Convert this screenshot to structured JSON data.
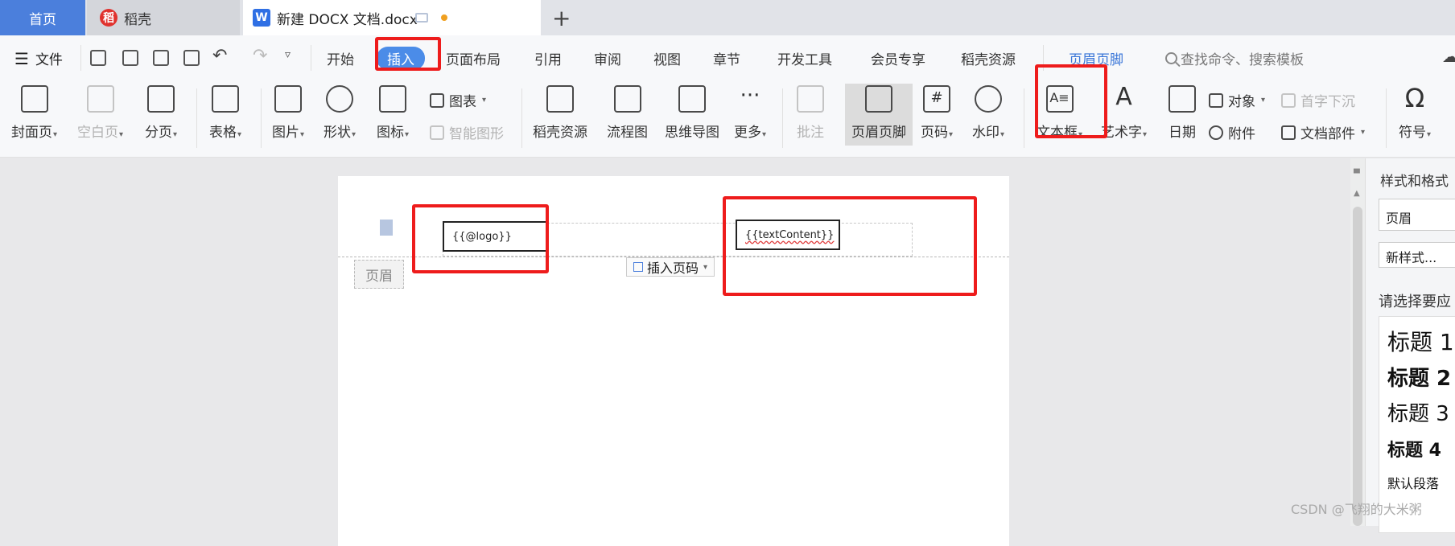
{
  "tabs": {
    "home": "首页",
    "daoke": "稻壳",
    "doc": "新建 DOCX 文档.docx"
  },
  "menu": {
    "file": "文件",
    "items": [
      "开始",
      "插入",
      "页面布局",
      "引用",
      "审阅",
      "视图",
      "章节",
      "开发工具",
      "会员专享",
      "稻壳资源",
      "页眉页脚"
    ],
    "active": "插入",
    "search_placeholder": "查找命令、搜索模板"
  },
  "ribbon": {
    "cover": "封面页",
    "blank": "空白页",
    "page_break": "分页",
    "table": "表格",
    "picture": "图片",
    "shape": "形状",
    "icon": "图标",
    "chart": "图表",
    "smart_art": "智能图形",
    "daoke_res": "稻壳资源",
    "flowchart": "流程图",
    "mindmap": "思维导图",
    "more": "更多",
    "comment": "批注",
    "header_footer": "页眉页脚",
    "page_num": "页码",
    "watermark": "水印",
    "textbox": "文本框",
    "wordart": "艺术字",
    "date": "日期",
    "object": "对象",
    "attachment": "附件",
    "drop_cap": "首字下沉",
    "doc_parts": "文档部件",
    "symbol": "符号"
  },
  "document": {
    "header_label": "页眉",
    "logo_field": "{{@logo}}",
    "text_field": "{{textContent}}",
    "insert_page_number": "插入页码"
  },
  "sidepane": {
    "title": "样式和格式",
    "current_style": "页眉",
    "new_style": "新样式...",
    "hint": "请选择要应",
    "styles": [
      "标题 1",
      "标题 2",
      "标题 3",
      "标题 4",
      "默认段落"
    ]
  },
  "watermark_text": "CSDN @飞翔的大米粥",
  "colors": {
    "accent": "#4b7fdc",
    "annotation": "#ee1c1c"
  }
}
